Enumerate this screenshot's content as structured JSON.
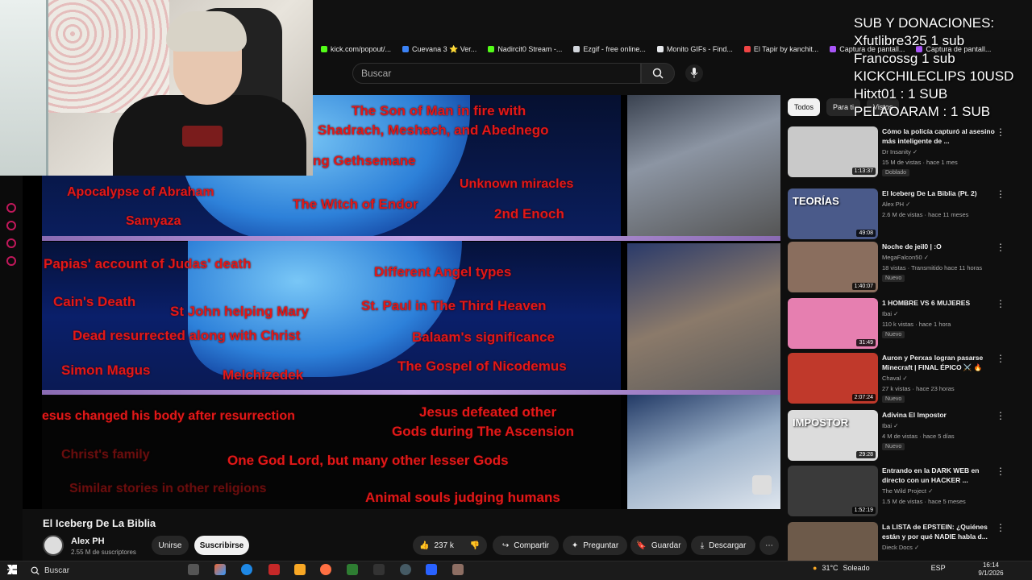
{
  "overlay": {
    "lines": [
      "SUB Y DONACIONES:",
      "Xfutlibre325 1 sub",
      "Francossg 1 sub",
      "KICKCHILECLIPS 10USD",
      "Hitxt01 : 1 SUB",
      "PELAOARAM : 1 SUB"
    ]
  },
  "bookmarks": [
    {
      "label": "kick.com/popout/...",
      "color": "#53fc18"
    },
    {
      "label": "Cuevana 3 ⭐ Ver...",
      "color": "#3b82f6"
    },
    {
      "label": "Nadircit0 Stream -...",
      "color": "#53fc18"
    },
    {
      "label": "Ezgif - free online...",
      "color": "#d1d5db"
    },
    {
      "label": "Monito GIFs - Find...",
      "color": "#e5e7eb"
    },
    {
      "label": "El Tapir by kanchit...",
      "color": "#ef4444"
    },
    {
      "label": "Captura de pantall...",
      "color": "#a855f7"
    },
    {
      "label": "Captura de pantall...",
      "color": "#a855f7"
    }
  ],
  "search": {
    "placeholder": "Buscar"
  },
  "video": {
    "texts": [
      "The Son of Man in fire with",
      "Shadrach, Meshach, and Abednego",
      "ng Gethsemane",
      "Unknown miracles",
      "Apocalypse of Abraham",
      "The Witch of Endor",
      "2nd Enoch",
      "Samyaza",
      "Papias' account of Judas' death",
      "Different Angel types",
      "Cain's Death",
      "St John helping Mary",
      "St. Paul in The Third Heaven",
      "Dead resurrected along with Christ",
      "Balaam's significance",
      "Simon Magus",
      "Melchizedek",
      "The Gospel of Nicodemus",
      "esus changed his body after resurrection",
      "Jesus defeated other",
      "Gods during The Ascension",
      "Christ's family",
      "One God Lord, but many other lesser Gods",
      "Similar stories in other religions",
      "Animal souls judging humans"
    ]
  },
  "watch": {
    "title": "El Iceberg De La Biblia",
    "channel": "Alex PH",
    "subscribers": "2.55 M de suscriptores",
    "join": "Unirse",
    "subscribe": "Suscribirse",
    "likes": "237 k",
    "share": "Compartir",
    "ask": "Preguntar",
    "save": "Guardar",
    "download": "Descargar"
  },
  "chips": [
    "Todos",
    "Para ti",
    "Vistos"
  ],
  "recommendations": [
    {
      "title": "Cómo la policía capturó al asesino más inteligente de ...",
      "channel": "Dr Insanity",
      "meta": "15 M de vistas · hace 1 mes",
      "badge": "Doblado",
      "duration": "1:13:37",
      "thumb": "#c9c9c9"
    },
    {
      "title": "El Iceberg De La Biblia (Pt. 2)",
      "channel": "Alex PH",
      "meta": "2.6 M de vistas · hace 11 meses",
      "badge": "",
      "duration": "49:08",
      "thumb": "#4a5a8a",
      "thumb_label": "TEORÍAS"
    },
    {
      "title": "Noche de jeil0 | :O",
      "channel": "MegaFalcon50",
      "meta": "18 vistas · Transmitido hace 11 horas",
      "badge": "Nuevo",
      "duration": "1:40:07",
      "thumb": "#8a6e5e"
    },
    {
      "title": "1 HOMBRE VS 6 MUJERES",
      "channel": "Ibai",
      "meta": "110 k vistas · hace 1 hora",
      "badge": "Nuevo",
      "duration": "31:49",
      "thumb": "#e67fb0"
    },
    {
      "title": "Auron y Perxas logran pasarse Minecraft | FINAL ÉPICO ⚔️ 🔥",
      "channel": "Chaval",
      "meta": "27 k vistas · hace 23 horas",
      "badge": "Nuevo",
      "duration": "2:07:24",
      "thumb": "#c0392b"
    },
    {
      "title": "Adivina El Impostor",
      "channel": "Ibai",
      "meta": "4 M de vistas · hace 5 días",
      "badge": "Nuevo",
      "duration": "29:28",
      "thumb": "#dcdcdc",
      "thumb_label": "IMPOSTOR"
    },
    {
      "title": "Entrando en la DARK WEB en directo con un HACKER ...",
      "channel": "The Wild Project",
      "meta": "1.5 M de vistas · hace 5 meses",
      "badge": "",
      "duration": "1:52:19",
      "thumb": "#3a3a3a"
    },
    {
      "title": "La LISTA de EPSTEIN: ¿Quiénes están y por qué NADIE habla d...",
      "channel": "Dieck Docs",
      "meta": "",
      "badge": "",
      "duration": "",
      "thumb": "#6d5a4a"
    }
  ],
  "taskbar": {
    "search": "Buscar",
    "weather": "31°C",
    "weather_text": "Soleado",
    "lang": "ESP",
    "time": "16:14",
    "date": "9/1/2026"
  }
}
